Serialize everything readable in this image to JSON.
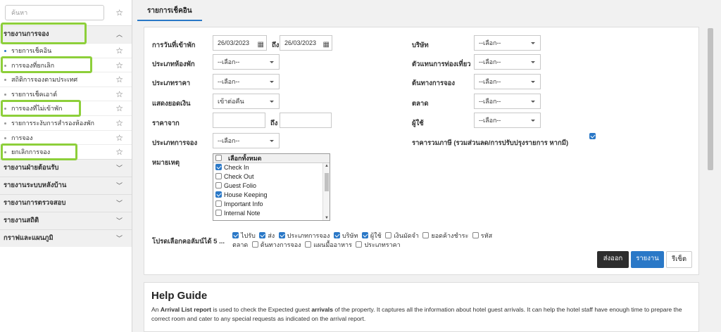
{
  "sidebar": {
    "search_placeholder": "ค้นหา",
    "sections": [
      {
        "label": "รายงานการจอง",
        "expanded": true
      },
      {
        "label": "รายงานฝ่ายต้อนรับ"
      },
      {
        "label": "รายงานระบบหลังบ้าน"
      },
      {
        "label": "รายงานการตรวจสอบ"
      },
      {
        "label": "รายงานสถิติ"
      },
      {
        "label": "กราฟและแผนภูมิ"
      }
    ],
    "items": [
      {
        "label": "รายการเช็คอิน",
        "active": true
      },
      {
        "label": "การจองที่ยกเลิก"
      },
      {
        "label": "สถิติการจองตามประเทศ"
      },
      {
        "label": "รายการเช็คเอาต์"
      },
      {
        "label": "การจองที่ไม่เข้าพัก"
      },
      {
        "label": "รายการระงับการสำรองห้องพัก"
      },
      {
        "label": "การจอง"
      },
      {
        "label": "ยกเลิกการจอง"
      }
    ]
  },
  "tab": {
    "label": "รายการเช็คอิน"
  },
  "form": {
    "checkin_date_label": "การวันที่เข้าพัก",
    "date_from": "26/03/2023",
    "to_label": "ถึง",
    "date_to": "26/03/2023",
    "room_type_label": "ประเภทห้องพัก",
    "rate_type_label": "ประเภทราคา",
    "show_amount_label": "แสดงยอดเงิน",
    "show_amount_value": "เข้าต่อคืน",
    "price_from_label": "ราคาจาก",
    "price_from_value": "",
    "price_to_value": "",
    "booking_type_label": "ประเภทการจอง",
    "notes_label": "หมายเหตุ",
    "company_label": "บริษัท",
    "travel_agent_label": "ตัวแทนการท่องเที่ยว",
    "booking_source_label": "ต้นทางการจอง",
    "market_label": "ตลาด",
    "user_label": "ผู้ใช้",
    "gross_rate_label": "ราคารวมภาษี (รวมส่วนลด/การปรับปรุงรายการ หากมี)",
    "gross_rate_checked": true,
    "select_placeholder": "--เลือก--",
    "notes_list": {
      "select_all": "เลือกทั้งหมด",
      "items": [
        {
          "label": "Check In",
          "checked": true
        },
        {
          "label": "Check Out",
          "checked": false
        },
        {
          "label": "Guest Folio",
          "checked": false
        },
        {
          "label": "House Keeping",
          "checked": true
        },
        {
          "label": "Important Info",
          "checked": false
        },
        {
          "label": "Internal Note",
          "checked": false
        }
      ]
    },
    "columns_label": "โปรดเลือกคอลัมน์ได้ 5 ...",
    "columns": [
      {
        "label": "ไปรับ",
        "checked": true
      },
      {
        "label": "ส่ง",
        "checked": true
      },
      {
        "label": "ประเภทการจอง",
        "checked": true
      },
      {
        "label": "บริษัท",
        "checked": true
      },
      {
        "label": "ผู้ใช้",
        "checked": true
      },
      {
        "label": "เงินมัดจำ",
        "checked": false
      },
      {
        "label": "ยอดค้างชำระ",
        "checked": false
      },
      {
        "label": "รหัส",
        "checked": false
      },
      {
        "label": "ตลาด",
        "checked": false
      },
      {
        "label": "ต้นทางการจอง",
        "checked": false
      },
      {
        "label": "แผนมื้ออาหาร",
        "checked": false
      },
      {
        "label": "ประเภทราคา",
        "checked": false
      }
    ]
  },
  "buttons": {
    "export": "ส่งออก",
    "report": "รายงาน",
    "reset": "รีเซ็ต"
  },
  "help": {
    "title": "Help Guide",
    "text_parts": [
      "An ",
      "Arrival List report",
      " is used to check the Expected guest ",
      "arrivals",
      " of the property. It captures all the information about hotel guest arrivals. It can help the hotel staff have enough time to prepare the correct room and cater to any special requests as indicated on the arrival report."
    ]
  },
  "colors": {
    "accent": "#2a78c7",
    "highlight": "#8dcf3a",
    "export_button": "#2d2d2d"
  }
}
